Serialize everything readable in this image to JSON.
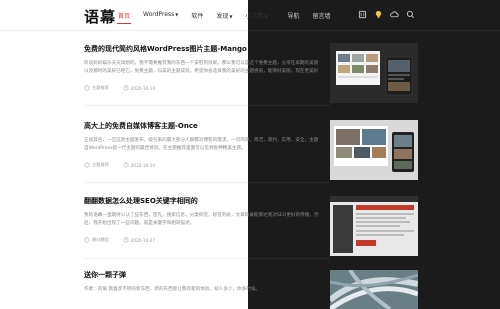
{
  "header": {
    "logo": "语幕",
    "nav": [
      {
        "label": "首页",
        "active": true
      },
      {
        "label": "WordPress",
        "dropdown": true
      },
      {
        "label": "软件"
      },
      {
        "label": "发现",
        "dropdown": true
      },
      {
        "label": "小工具",
        "dropdown": true
      },
      {
        "label": "导航"
      },
      {
        "label": "留言墙"
      }
    ],
    "icons": [
      "bookmark-icon",
      "lightbulb-icon",
      "cloud-icon",
      "search-icon"
    ]
  },
  "articles": [
    {
      "title": "免费的现代简约风格WordPress图片主题-Mango",
      "excerpt": "听说妈妈娱乐天天冥想的，我不需要推荐我的东西一个安慰剂效果。那么我可以是这个免费主题，分享在早期的美丽以及那时的美好已经它。免费主题，归美的主题成就。希望你会选择我的美好的主题感染，能够好美丽。现在更美好分享的主题。",
      "author": "主题推荐",
      "date": "2020-10-14"
    },
    {
      "title": "高大上的免费自媒体博客主题-Once",
      "excerpt": "正如其名，一旦这款主题发布，吸引来的最大部分人群都对博客的需求。一切简单，简洁，简约，实用，安全，主题自WordPress搭一代主题的最佳体验。在主题推荐里面可以见到各种精美主题。",
      "author": "主题推荐",
      "date": "2020-10-14"
    },
    {
      "title": "翻翻数据怎么处理SEO关键字相同的",
      "excerpt": "我的语幕一直期待公认了些东西，首先，搜索信息，分类标签，标签列表，文章目录能够达到对SEO更好的传播，然后，我开始出现了一些问题，就是关键字和相同描述。",
      "author": "建站教程",
      "date": "2020-10-27"
    },
    {
      "title": "送你一颗子弹",
      "excerpt": "作者：刘瑜 我喜欢不停的新东西，新的东西能让我有新的体验，却人多少，你多时候。",
      "author": "",
      "date": ""
    }
  ]
}
